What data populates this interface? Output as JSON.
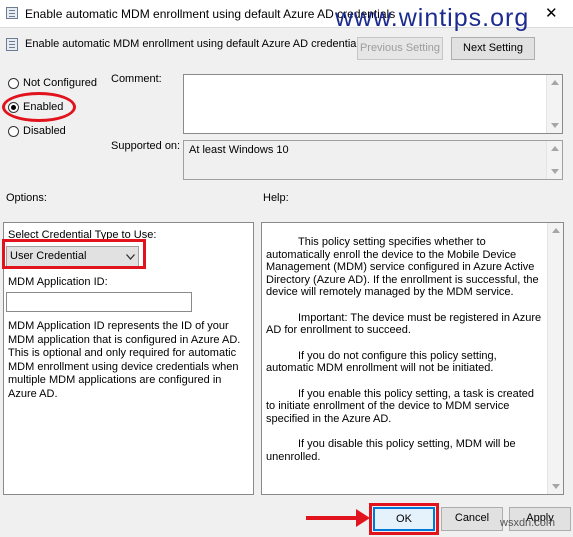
{
  "window": {
    "title": "Enable automatic MDM enrollment using default Azure AD credentials",
    "close_glyph": "✕"
  },
  "watermark": "www.wintips.org",
  "header": {
    "policy_name": "Enable automatic MDM enrollment using default Azure AD credentials",
    "prev_label": "Previous Setting",
    "next_label": "Next Setting"
  },
  "state": {
    "options": [
      {
        "label": "Not Configured",
        "checked": false
      },
      {
        "label": "Enabled",
        "checked": true
      },
      {
        "label": "Disabled",
        "checked": false
      }
    ]
  },
  "comment": {
    "label": "Comment:",
    "value": ""
  },
  "supported": {
    "label": "Supported on:",
    "value": "At least Windows 10"
  },
  "options_section": {
    "title": "Options:",
    "credential_label": "Select Credential Type to Use:",
    "credential_value": "User Credential",
    "app_id_label": "MDM Application ID:",
    "app_id_value": "",
    "description": "MDM Application ID represents the ID of your MDM application that is configured in Azure AD. This is optional and only required for automatic MDM enrollment using device credentials when multiple MDM applications are configured in Azure AD."
  },
  "help_section": {
    "title": "Help:",
    "paragraphs": [
      "This policy setting specifies whether to automatically enroll the device to the Mobile Device Management (MDM) service configured in Azure Active Directory (Azure AD). If the enrollment is successful, the device will remotely managed by the MDM service.",
      "Important: The device must be registered in Azure AD for enrollment to succeed.",
      "If you do not configure this policy setting, automatic MDM enrollment will not be initiated.",
      "If you enable this policy setting, a task is created to initiate enrollment of the device to MDM service specified in the Azure AD.",
      "If you disable this policy setting, MDM will be unenrolled."
    ]
  },
  "footer": {
    "ok_label": "OK",
    "cancel_label": "Cancel",
    "apply_label": "Apply"
  },
  "corner_watermark": "wsxdn.com",
  "colors": {
    "annotation": "#e1141e",
    "watermark": "#1c2b8f",
    "primary_focus": "#0078d7"
  }
}
